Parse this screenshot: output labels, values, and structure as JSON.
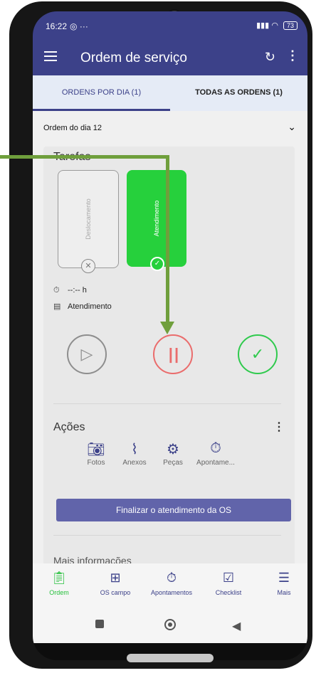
{
  "status_bar": {
    "time": "16:22",
    "battery": "73"
  },
  "app_bar": {
    "title": "Ordem de serviço",
    "refresh_icon": "refresh-icon",
    "more_icon": "more-vert-icon"
  },
  "tabs": [
    {
      "label": "ORDENS POR DIA (1)",
      "selected": true
    },
    {
      "label": "TODAS AS ORDENS (1)",
      "selected": false
    }
  ],
  "order_section": {
    "label": "Ordem do dia 12"
  },
  "tasks": {
    "title": "Tarefas",
    "items": [
      {
        "label": "Deslocamento",
        "state": "cancelled"
      },
      {
        "label": "Atendimento",
        "state": "active"
      }
    ]
  },
  "task_info": {
    "duration": "--:-- h",
    "current_task": "Atendimento"
  },
  "controls": {
    "play": "play",
    "pause": "pause",
    "done": "done"
  },
  "actions": {
    "title": "Ações",
    "items": [
      {
        "label": "Fotos",
        "icon": "camera-icon"
      },
      {
        "label": "Anexos",
        "icon": "paperclip-icon"
      },
      {
        "label": "Peças",
        "icon": "parts-icon"
      },
      {
        "label": "Apontame...",
        "icon": "timer-icon"
      }
    ],
    "finalize_label": "Finalizar o atendimento da OS"
  },
  "more_info": {
    "label": "Mais informações"
  },
  "bottom_nav": [
    {
      "label": "Ordem",
      "active": true
    },
    {
      "label": "OS campo",
      "active": false
    },
    {
      "label": "Apontamentos",
      "active": false
    },
    {
      "label": "Checklist",
      "active": false
    },
    {
      "label": "Mais",
      "active": false
    }
  ],
  "colors": {
    "primary": "#3c4189",
    "accent_green": "#26d03c",
    "pause_red": "#ea6c6c",
    "annotation_arrow": "#6f9f3c"
  }
}
